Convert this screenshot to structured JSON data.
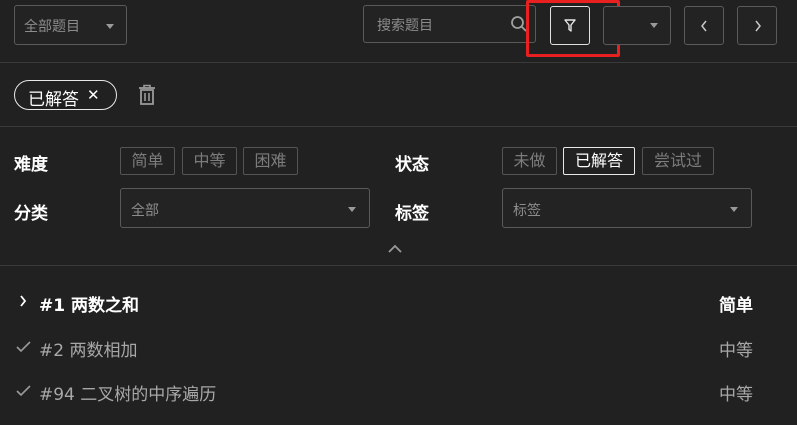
{
  "toolbar": {
    "category_select": "全部题目",
    "search_placeholder": "搜索题目",
    "sort_select": ""
  },
  "active_filters": {
    "chip_label": "已解答",
    "remove_symbol": "✕"
  },
  "filters": {
    "difficulty_label": "难度",
    "difficulty_options": [
      "简单",
      "中等",
      "困难"
    ],
    "status_label": "状态",
    "status_options": [
      "未做",
      "已解答",
      "尝试过"
    ],
    "status_selected": "已解答",
    "category_label": "分类",
    "category_value": "全部",
    "tag_label": "标签",
    "tag_placeholder": "标签"
  },
  "problems": [
    {
      "title": "#1 两数之和",
      "difficulty": "简单",
      "state": "current"
    },
    {
      "title": "#2 两数相加",
      "difficulty": "中等",
      "state": "solved"
    },
    {
      "title": "#94 二叉树的中序遍历",
      "difficulty": "中等",
      "state": "solved"
    }
  ],
  "colors": {
    "background": "#212121",
    "highlight_box": "#e8201f",
    "border": "#5a5a5a"
  }
}
